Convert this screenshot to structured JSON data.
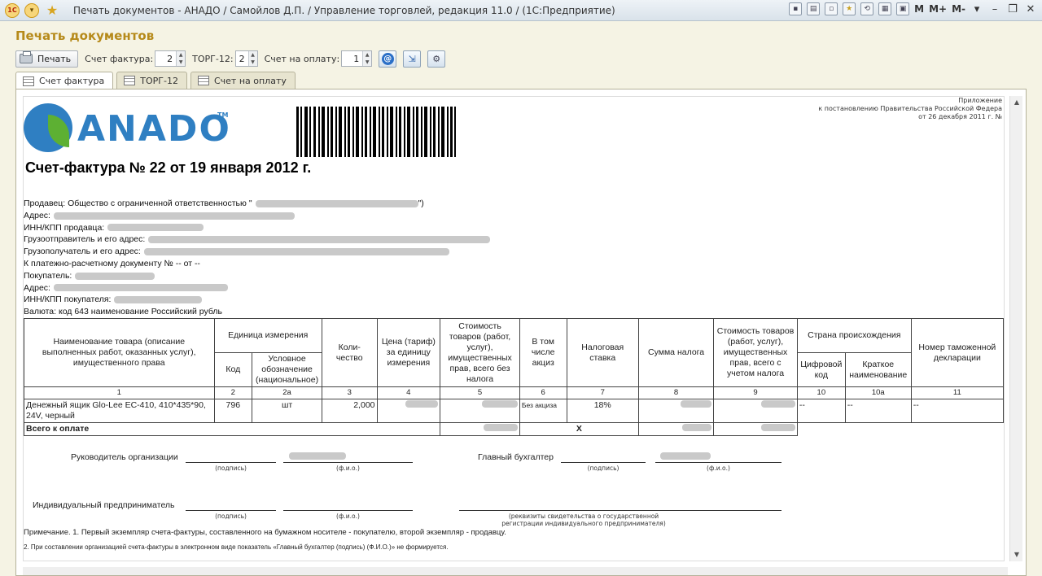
{
  "window": {
    "title": "Печать документов - АНАДО / Самойлов Д.П. /  Управление торговлей, редакция 11.0 /  (1С:Предприятие)",
    "logo_text": "1С",
    "right_controls": [
      "M",
      "M+",
      "M-"
    ]
  },
  "form": {
    "title": "Печать документов",
    "print_label": "Печать",
    "copies": [
      {
        "label": "Счет фактура:",
        "value": "2"
      },
      {
        "label": "ТОРГ-12:",
        "value": "2"
      },
      {
        "label": "Счет на оплату:",
        "value": "1"
      }
    ],
    "email_icon": "@"
  },
  "tabs": [
    {
      "label": "Счет фактура",
      "active": true
    },
    {
      "label": "ТОРГ-12",
      "active": false
    },
    {
      "label": "Счет на оплату",
      "active": false
    }
  ],
  "document": {
    "logo_text": "ANADO",
    "logo_tm": "TM",
    "appendix": [
      "Приложение",
      "к постановлению Правительства Российской Федера",
      "от 26 декабря 2011 г. №"
    ],
    "title": "Счет-фактура № 22 от 19 января 2012 г.",
    "info": [
      "Продавец: Общество с ограниченной ответственностью \"",
      "Адрес:",
      "ИНН/КПП продавца:",
      "Грузоотправитель и его адрес:",
      "Грузополучатель и его адрес:",
      "К платежно-расчетному документу № -- от --",
      "Покупатель:",
      "Адрес:",
      "ИНН/КПП покупателя:",
      "Валюта: код 643 наименование Российский рубль"
    ],
    "seller_close": "\")",
    "table": {
      "headers": {
        "name": "Наименование товара (описание выполненных работ, оказанных услуг), имущественного права",
        "unit": "Единица измерения",
        "unit_code": "Код",
        "unit_name": "Условное обозначение (национальное)",
        "qty": "Коли- чество",
        "price": "Цена (тариф) за единицу измерения",
        "cost": "Стоимость товаров (работ, услуг), имущественных прав, всего без налога",
        "excise": "В том числе акциз",
        "rate": "Налоговая ставка",
        "tax": "Сумма налога",
        "cost_tax": "Стоимость товаров (работ, услуг), имущественных прав, всего с учетом налога",
        "country": "Страна происхождения",
        "country_code": "Цифровой код",
        "country_name": "Краткое наименование",
        "customs": "Номер таможенной декларации"
      },
      "col_numbers": [
        "1",
        "2",
        "2а",
        "3",
        "4",
        "5",
        "6",
        "7",
        "8",
        "9",
        "10",
        "10а",
        "11"
      ],
      "row": {
        "name": "Денежный ящик Glo-Lee EC-410, 410*435*90, 24V, черный",
        "code": "796",
        "unit": "шт",
        "qty": "2,000",
        "excise": "Без акциза",
        "rate": "18%",
        "country_code": "--",
        "country_name": "--",
        "customs": "--"
      },
      "total_label": "Всего к оплате",
      "total_x": "X"
    },
    "signatures": {
      "head": "Руководитель организации",
      "accountant": "Главный бухгалтер",
      "entrepreneur": "Индивидуальный предприниматель",
      "cap_sign": "(подпись)",
      "cap_fio": "(ф.и.о.)",
      "cap_requisites_1": "(реквизиты свидетельства о государственной",
      "cap_requisites_2": "регистрации индивидуального предпринимателя)"
    },
    "notes": [
      "Примечание. 1. Первый экземпляр счета-фактуры, составленного на бумажном носителе - покупателю, второй экземпляр - продавцу.",
      "2. При составлении организацией счета-фактуры в электронном виде показатель «Главный бухгалтер (подпись) (Ф.И.О.)» не формируется."
    ]
  }
}
